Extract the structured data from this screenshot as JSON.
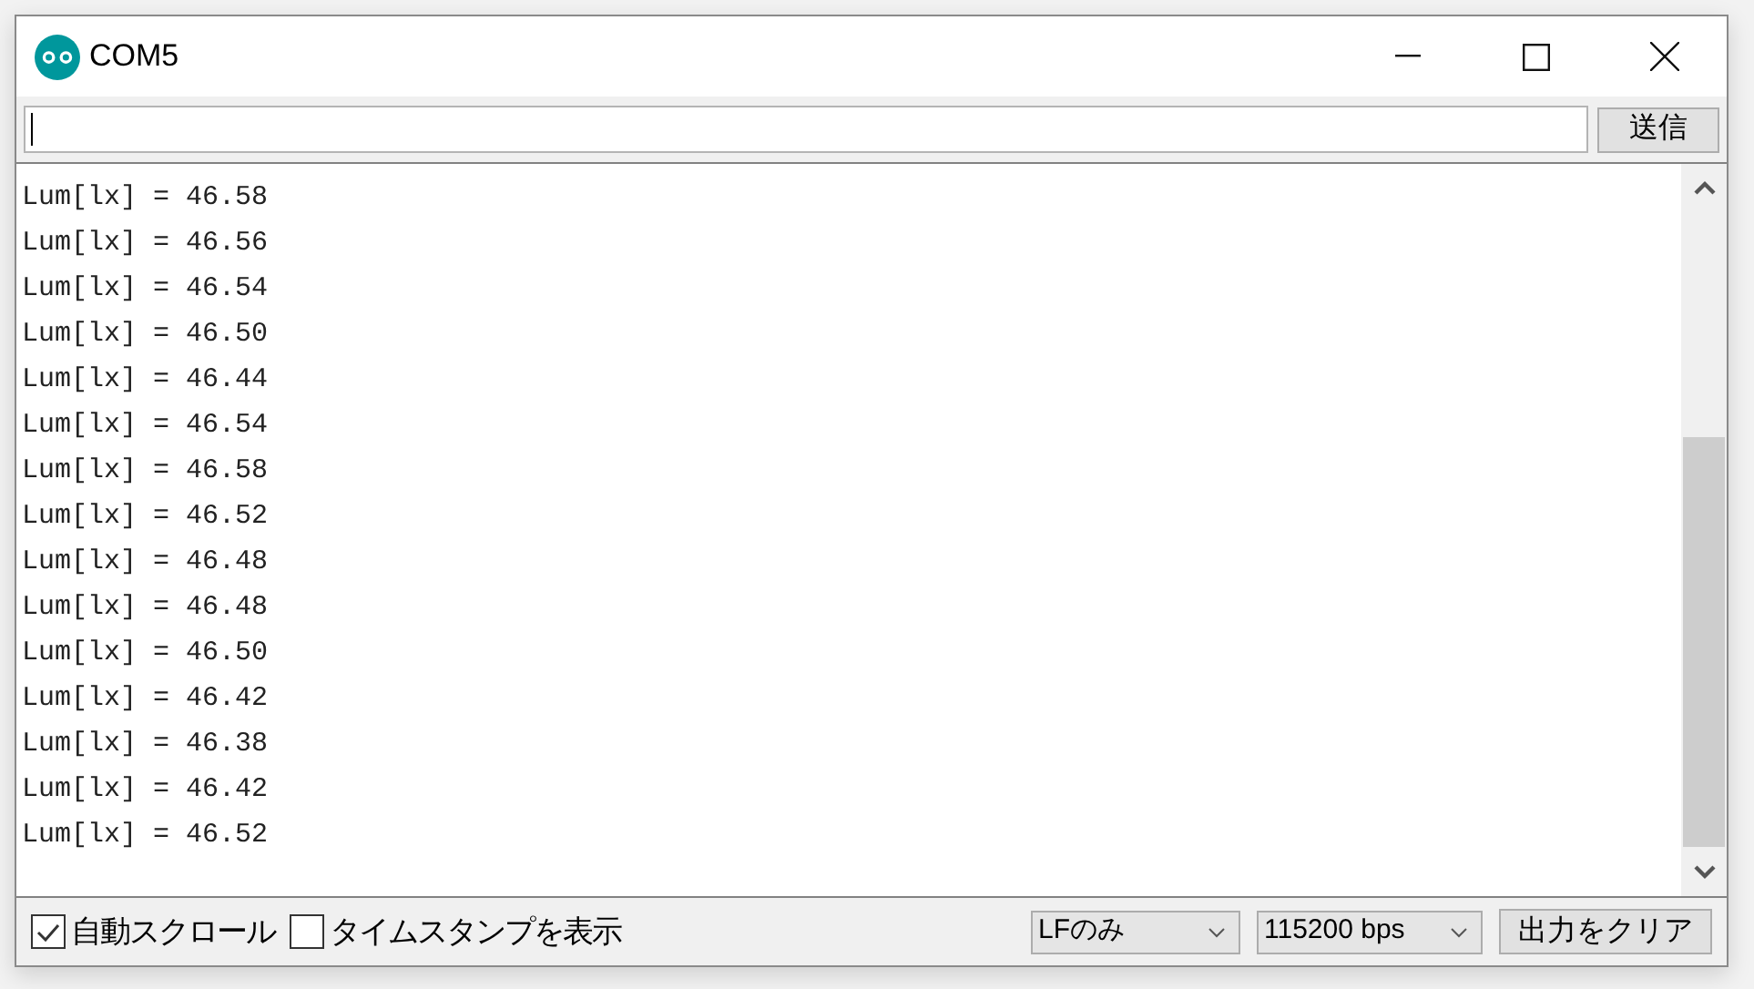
{
  "window": {
    "title": "COM5"
  },
  "send_button": "送信",
  "output_lines": [
    "Lum[lx] = 46.58",
    "Lum[lx] = 46.56",
    "Lum[lx] = 46.54",
    "Lum[lx] = 46.50",
    "Lum[lx] = 46.44",
    "Lum[lx] = 46.54",
    "Lum[lx] = 46.58",
    "Lum[lx] = 46.52",
    "Lum[lx] = 46.48",
    "Lum[lx] = 46.48",
    "Lum[lx] = 46.50",
    "Lum[lx] = 46.42",
    "Lum[lx] = 46.38",
    "Lum[lx] = 46.42",
    "Lum[lx] = 46.52"
  ],
  "options": [
    {
      "label": "自動スクロール",
      "checked": true
    },
    {
      "label": "タイムスタンプを表示",
      "checked": false
    }
  ],
  "line_ending": "LFのみ",
  "baud_rate": "115200 bps",
  "clear_button": "出力をクリア"
}
